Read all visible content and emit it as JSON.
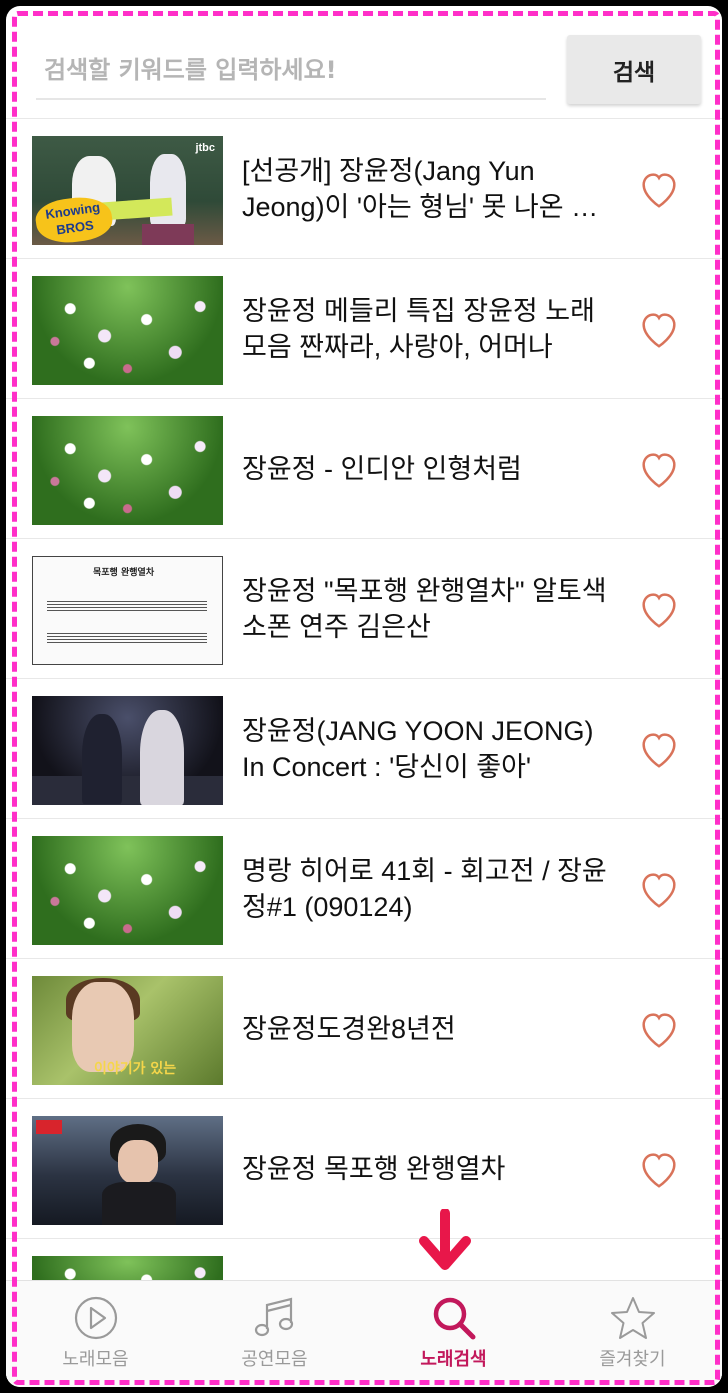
{
  "search": {
    "placeholder": "검색할 키워드를 입력하세요!",
    "button_label": "검색"
  },
  "results": [
    {
      "title": "[선공개] 장윤정(Jang Yun Jeong)이 '아는 형님' 못 나온 이유",
      "thumb": "jtbc-knowing-bros",
      "favorite": false,
      "thumb_text_logo": "Knowing BROS",
      "thumb_text_channel": "jtbc"
    },
    {
      "title": "장윤정 메들리 특집 장윤정 노래 모음 짠짜라, 사랑아, 어머나",
      "thumb": "flowers",
      "favorite": false
    },
    {
      "title": "장윤정 - 인디안 인형처럼",
      "thumb": "flowers",
      "favorite": false
    },
    {
      "title": "장윤정 \"목포행 완행열차\" 알토색소폰 연주 김은산",
      "thumb": "sheet-music",
      "favorite": false,
      "thumb_text_heading": "목포행 완행열차"
    },
    {
      "title": "장윤정(JANG YOON JEONG) In Concert : '당신이 좋아'",
      "thumb": "concert",
      "favorite": false
    },
    {
      "title": "명랑 히어로 41회 - 회고전 / 장윤정#1 (090124)",
      "thumb": "flowers",
      "favorite": false
    },
    {
      "title": "장윤정도경완8년전",
      "thumb": "sbs-interview",
      "favorite": false,
      "thumb_text_caption": "이야기가 있는"
    },
    {
      "title": "장윤정 목포행 완행열차",
      "thumb": "stage",
      "favorite": false
    }
  ],
  "nav": {
    "items": [
      {
        "label": "노래모음",
        "icon": "play-circle-icon",
        "active": false
      },
      {
        "label": "공연모음",
        "icon": "music-note-icon",
        "active": false
      },
      {
        "label": "노래검색",
        "icon": "search-icon",
        "active": true
      },
      {
        "label": "즐겨찾기",
        "icon": "star-icon",
        "active": false
      }
    ]
  },
  "colors": {
    "accent": "#c2185b",
    "heart": "#d9735a",
    "annotation_arrow": "#e8174a",
    "dashed_border": "#ff2ec8"
  }
}
